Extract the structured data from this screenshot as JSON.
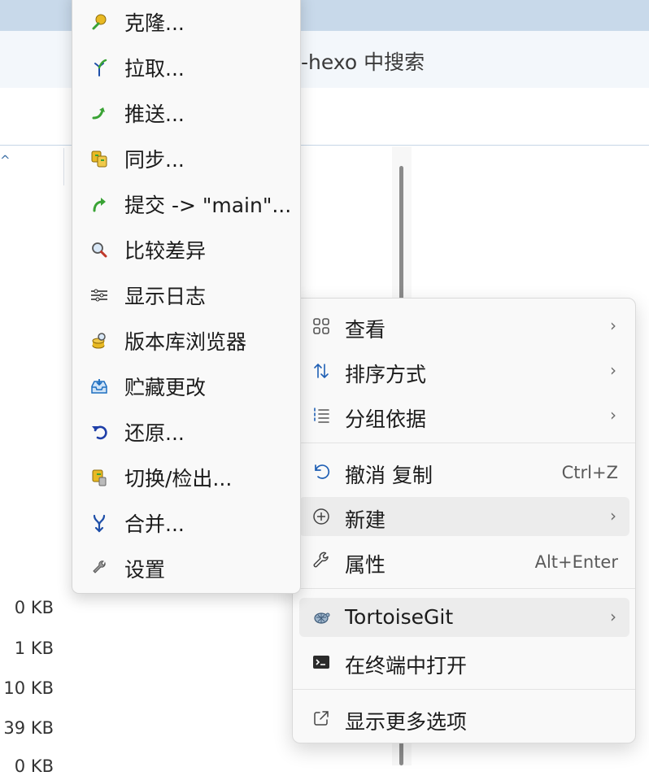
{
  "explorer": {
    "search_placeholder": "-hexo 中搜索",
    "file_sizes": [
      "0 KB",
      "1 KB",
      "10 KB",
      "39 KB",
      "0 KB"
    ]
  },
  "tortoise_submenu": {
    "items": [
      {
        "label": "克隆...",
        "icon": "clone-icon"
      },
      {
        "label": "拉取...",
        "icon": "pull-icon"
      },
      {
        "label": "推送...",
        "icon": "push-icon"
      },
      {
        "label": "同步...",
        "icon": "sync-icon"
      },
      {
        "label": "提交 -> \"main\"...",
        "icon": "commit-icon"
      },
      {
        "label": "比较差异",
        "icon": "diff-icon"
      },
      {
        "label": "显示日志",
        "icon": "log-icon"
      },
      {
        "label": "版本库浏览器",
        "icon": "repo-browser-icon"
      },
      {
        "label": "贮藏更改",
        "icon": "stash-icon"
      },
      {
        "label": "还原...",
        "icon": "revert-icon"
      },
      {
        "label": "切换/检出...",
        "icon": "switch-checkout-icon"
      },
      {
        "label": "合并...",
        "icon": "merge-icon"
      },
      {
        "label": "设置",
        "icon": "settings-icon"
      }
    ]
  },
  "context_menu": {
    "view": {
      "label": "查看",
      "icon": "grid-view-icon"
    },
    "sort": {
      "label": "排序方式",
      "icon": "sort-icon"
    },
    "group": {
      "label": "分组依据",
      "icon": "group-list-icon"
    },
    "undo": {
      "label": "撤消 复制",
      "shortcut": "Ctrl+Z",
      "icon": "undo-icon"
    },
    "new": {
      "label": "新建",
      "icon": "plus-circle-icon"
    },
    "properties": {
      "label": "属性",
      "shortcut": "Alt+Enter",
      "icon": "wrench-icon"
    },
    "tortoisegit": {
      "label": "TortoiseGit",
      "icon": "tortoise-icon"
    },
    "terminal": {
      "label": "在终端中打开",
      "icon": "terminal-icon"
    },
    "more": {
      "label": "显示更多选项",
      "icon": "external-link-icon"
    },
    "submenu_arrow": "›"
  },
  "colors": {
    "menu_bg": "#f9f9f9",
    "highlight": "#ececec",
    "accent_blue": "#1f5fb4",
    "git_green": "#3aa335",
    "titlebar": "#c8d9ea"
  }
}
